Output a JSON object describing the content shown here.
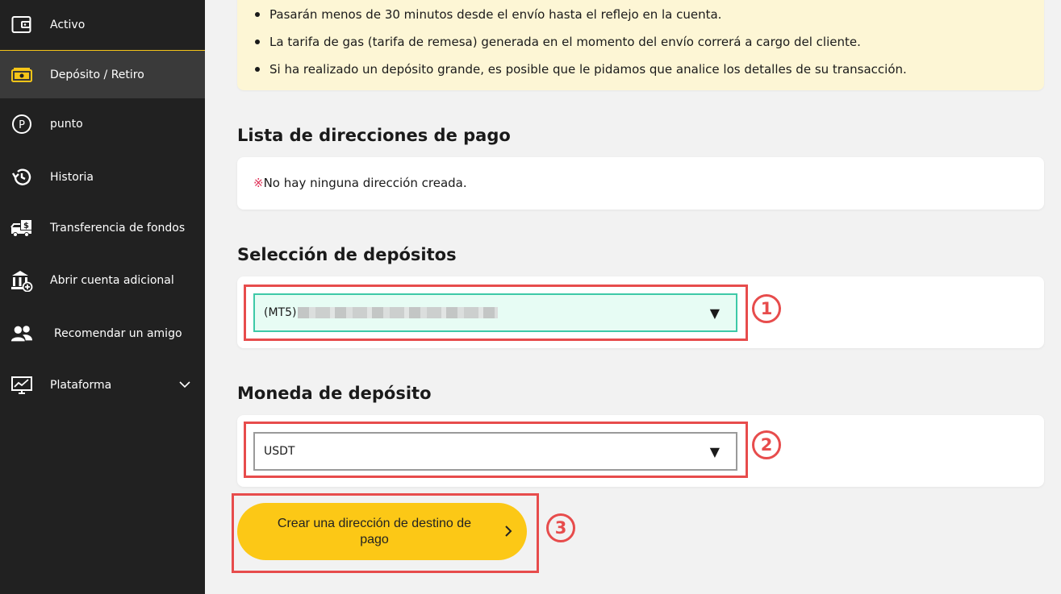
{
  "sidebar": {
    "items": [
      {
        "label": "Activo",
        "icon": "wallet-icon"
      },
      {
        "label": "Depósito / Retiro",
        "icon": "cash-icon"
      },
      {
        "label": "punto",
        "icon": "point-icon"
      },
      {
        "label": "Historia",
        "icon": "history-icon"
      },
      {
        "label": "Transferencia de fondos",
        "icon": "transfer-truck-icon"
      },
      {
        "label": "Abrir cuenta adicional",
        "icon": "bank-add-icon"
      },
      {
        "label": "Recomendar un amigo",
        "icon": "users-icon"
      },
      {
        "label": "Plataforma",
        "icon": "monitor-chart-icon"
      }
    ],
    "accent_color": "#f5c518"
  },
  "notice": {
    "items": [
      "Pasarán menos de 30 minutos desde el envío hasta el reflejo en la cuenta.",
      "La tarifa de gas (tarifa de remesa) generada en el momento del envío correrá a cargo del cliente.",
      "Si ha realizado un depósito grande, es posible que le pidamos que analice los detalles de su transacción."
    ]
  },
  "addresses": {
    "title": "Lista de direcciones de pago",
    "empty_mark": "※",
    "empty_text": "No hay ninguna dirección creada."
  },
  "deposit_selection": {
    "title": "Selección de depósitos",
    "value_prefix": "(MT5)",
    "step": "1"
  },
  "deposit_currency": {
    "title": "Moneda de depósito",
    "value": "USDT",
    "step": "2"
  },
  "cta": {
    "label": "Crear una dirección de destino de pago",
    "step": "3",
    "color": "#fcc816"
  },
  "highlight_color": "#e74c4c"
}
